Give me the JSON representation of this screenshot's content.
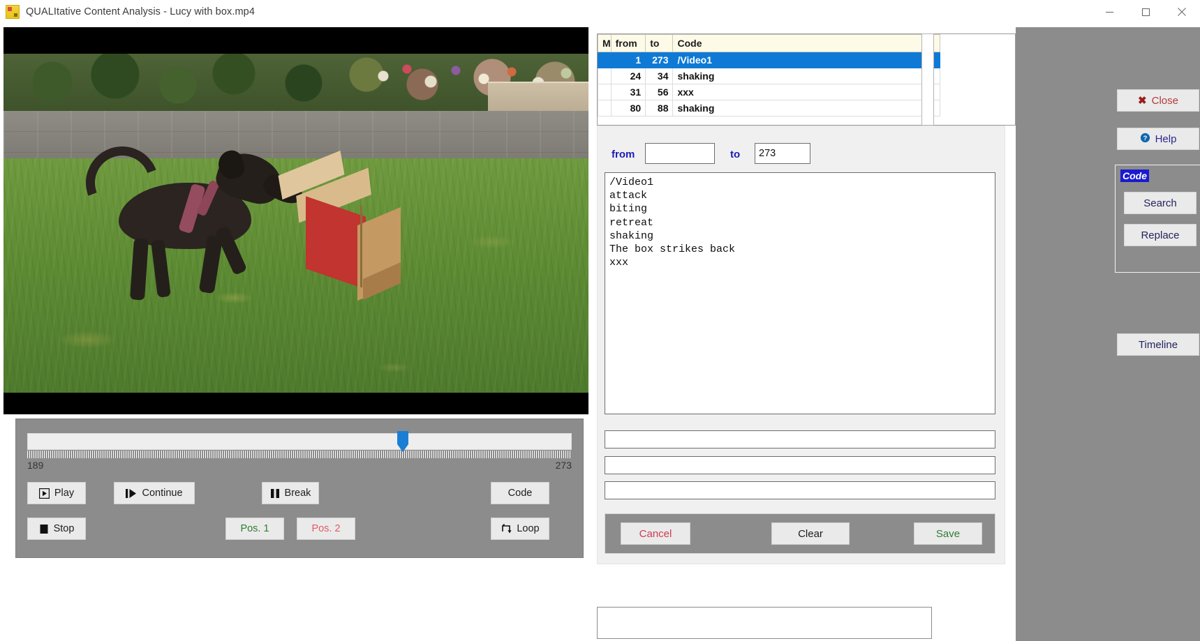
{
  "window": {
    "title": "QUALItative Content Analysis - Lucy with box.mp4",
    "icon": "app-icon",
    "minimize_label": "–",
    "maximize_label": "□",
    "close_label": "✕"
  },
  "video": {
    "frame_description": "black dog attacking a red and brown cardboard box on grass lawn"
  },
  "transport": {
    "slider": {
      "start_label": "189",
      "end_label": "273",
      "position_percent": 68
    },
    "buttons": {
      "play": "Play",
      "continue": "Continue",
      "break": "Break",
      "code": "Code",
      "stop": "Stop",
      "pos1": "Pos. 1",
      "pos2": "Pos. 2",
      "loop": "Loop"
    },
    "colors": {
      "pos1": "#2e7d32",
      "pos2": "#e05a6a"
    }
  },
  "codes_table": {
    "headers": [
      "M",
      "from",
      "to",
      "Code"
    ],
    "rows": [
      {
        "m": "",
        "from": "1",
        "to": "273",
        "code": "/Video1",
        "selected": true
      },
      {
        "m": "",
        "from": "24",
        "to": "34",
        "code": "shaking",
        "selected": false
      },
      {
        "m": "",
        "from": "31",
        "to": "56",
        "code": "xxx",
        "selected": false
      },
      {
        "m": "",
        "from": "80",
        "to": "88",
        "code": "shaking",
        "selected": false
      }
    ],
    "selected_color": "#0f7ad6",
    "header_color": "#fdfbe8"
  },
  "coding_panel": {
    "from_label": "from",
    "to_label": "to",
    "from_value": "",
    "to_value": "273",
    "code_list_text": "/Video1\nattack\nbiting\nretreat\nshaking\nThe box strikes back\nxxx",
    "slot_1": "",
    "slot_2": "",
    "slot_3": "",
    "actions": {
      "cancel": "Cancel",
      "clear": "Clear",
      "save": "Save"
    },
    "action_colors": {
      "cancel": "#d03a52",
      "save": "#2e7d32"
    }
  },
  "sidebar": {
    "close": "Close",
    "help": "Help",
    "group_label": "Code",
    "search": "Search",
    "replace": "Replace",
    "timeline": "Timeline"
  },
  "bottom": {
    "field_value": ""
  }
}
